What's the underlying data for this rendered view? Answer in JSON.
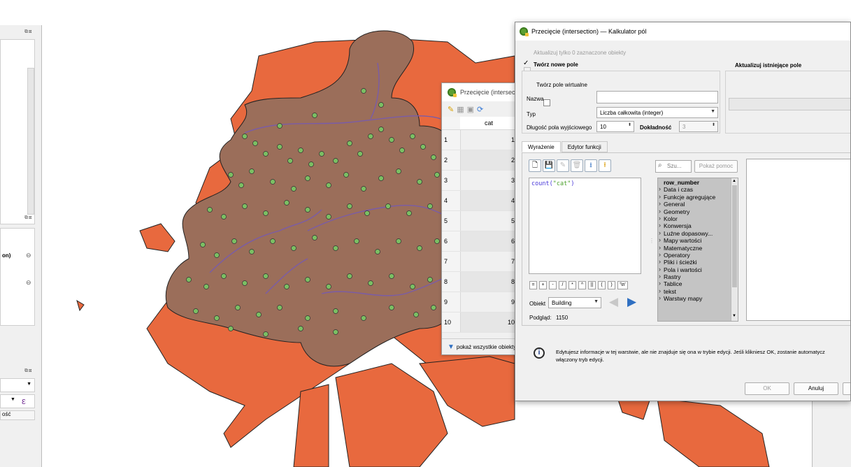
{
  "colors": {
    "map_orange": "#e8693e",
    "buffer_brown": "#9b6e5a",
    "point_green": "#7bbf63",
    "river_purple": "#7a5ca8"
  },
  "left_panels": {
    "label_on": "on)",
    "label_osc": "ość",
    "icon_expression": "ε"
  },
  "attribute_table": {
    "title": "Przecięcie (intersec",
    "column": "cat",
    "rows": [
      {
        "n": "1",
        "v": "1"
      },
      {
        "n": "2",
        "v": "2"
      },
      {
        "n": "3",
        "v": "3"
      },
      {
        "n": "4",
        "v": "4"
      },
      {
        "n": "5",
        "v": "5"
      },
      {
        "n": "6",
        "v": "6"
      },
      {
        "n": "7",
        "v": "7"
      },
      {
        "n": "8",
        "v": "8"
      },
      {
        "n": "9",
        "v": "9"
      },
      {
        "n": "10",
        "v": "10"
      }
    ],
    "footer": "pokaż wszystkie obiekty"
  },
  "dialog": {
    "title": "Przecięcie (intersection) — Kalkulator pól",
    "update_selected": "Aktualizuj tylko 0 zaznaczone obiekty",
    "create_new_field": "Twórz nowe pole",
    "update_existing": "Aktualizuj istniejące pole",
    "create_virtual": "Twórz pole wirtualne",
    "name_label": "Nazwa",
    "name_value": "",
    "type_label": "Typ",
    "type_value": "Liczba całkowita (integer)",
    "length_label": "Długość pola wyjściowego",
    "length_value": "10",
    "precision_label": "Dokładność",
    "precision_value": "3",
    "tabs": [
      "Wyrażenie",
      "Edytor funkcji"
    ],
    "expression_plain_1": "count(",
    "expression_string": "\"cat\"",
    "expression_plain_2": ")",
    "operators": [
      "=",
      "+",
      "-",
      "/",
      "*",
      "^",
      "||",
      "(",
      ")",
      "'\\n'"
    ],
    "feature_label": "Obiekt",
    "feature_value": "Building",
    "preview_label": "Podgląd:",
    "preview_value": "1150",
    "search_placeholder": "Szu...",
    "show_help": "Pokaż pomoc",
    "function_groups": [
      "row_number",
      "Data i czas",
      "Funkcje agregujące",
      "General",
      "Geometry",
      "Kolor",
      "Konwersja",
      "Luźne dopasowy...",
      "Mapy wartości",
      "Matematyczne",
      "Operatory",
      "Pliki i ścieżki",
      "Pola i wartości",
      "Rastry",
      "Tablice",
      "tekst",
      "Warstwy mapy"
    ],
    "info_text_1": "Edytujesz informacje w tej warstwie, ale nie znajduje się ona w trybie edycji. Jeśli klikniesz OK, zostanie automatycz",
    "info_text_2": "włączony tryb edycji.",
    "ok": "OK",
    "cancel": "Anuluj"
  }
}
